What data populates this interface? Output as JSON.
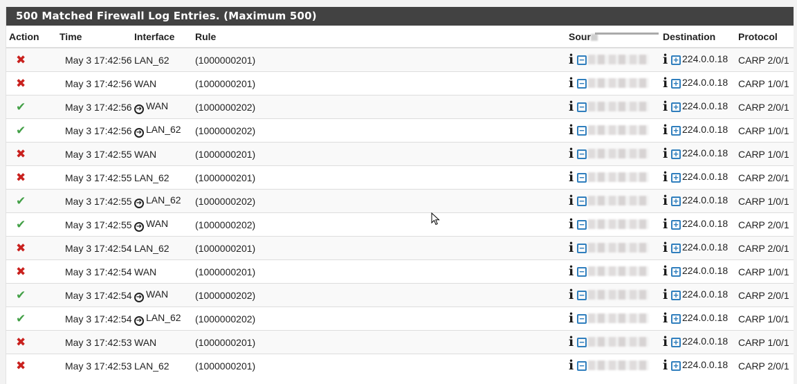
{
  "panel": {
    "title": "500 Matched Firewall Log Entries. (Maximum 500)"
  },
  "table": {
    "headers": {
      "action": "Action",
      "time": "Time",
      "interface": "Interface",
      "rule": "Rule",
      "source": "Sour",
      "destination": "Destination",
      "protocol": "Protocol"
    },
    "rows": [
      {
        "action": "block",
        "time": "May 3 17:42:56",
        "interface": "LAN_62",
        "direction_icon": false,
        "rule": "(1000000201)",
        "source": "[redacted]",
        "destination": "224.0.0.18",
        "protocol": "CARP 2/0/1"
      },
      {
        "action": "block",
        "time": "May 3 17:42:56",
        "interface": "WAN",
        "direction_icon": false,
        "rule": "(1000000201)",
        "source": "[redacted]",
        "destination": "224.0.0.18",
        "protocol": "CARP 1/0/1"
      },
      {
        "action": "pass",
        "time": "May 3 17:42:56",
        "interface": "WAN",
        "direction_icon": true,
        "rule": "(1000000202)",
        "source": "[redacted]",
        "destination": "224.0.0.18",
        "protocol": "CARP 2/0/1"
      },
      {
        "action": "pass",
        "time": "May 3 17:42:56",
        "interface": "LAN_62",
        "direction_icon": true,
        "rule": "(1000000202)",
        "source": "[redacted]",
        "destination": "224.0.0.18",
        "protocol": "CARP 1/0/1"
      },
      {
        "action": "block",
        "time": "May 3 17:42:55",
        "interface": "WAN",
        "direction_icon": false,
        "rule": "(1000000201)",
        "source": "[redacted]",
        "destination": "224.0.0.18",
        "protocol": "CARP 1/0/1"
      },
      {
        "action": "block",
        "time": "May 3 17:42:55",
        "interface": "LAN_62",
        "direction_icon": false,
        "rule": "(1000000201)",
        "source": "[redacted]",
        "destination": "224.0.0.18",
        "protocol": "CARP 2/0/1"
      },
      {
        "action": "pass",
        "time": "May 3 17:42:55",
        "interface": "LAN_62",
        "direction_icon": true,
        "rule": "(1000000202)",
        "source": "[redacted]",
        "destination": "224.0.0.18",
        "protocol": "CARP 1/0/1"
      },
      {
        "action": "pass",
        "time": "May 3 17:42:55",
        "interface": "WAN",
        "direction_icon": true,
        "rule": "(1000000202)",
        "source": "[redacted]",
        "destination": "224.0.0.18",
        "protocol": "CARP 2/0/1"
      },
      {
        "action": "block",
        "time": "May 3 17:42:54",
        "interface": "LAN_62",
        "direction_icon": false,
        "rule": "(1000000201)",
        "source": "[redacted]",
        "destination": "224.0.0.18",
        "protocol": "CARP 2/0/1"
      },
      {
        "action": "block",
        "time": "May 3 17:42:54",
        "interface": "WAN",
        "direction_icon": false,
        "rule": "(1000000201)",
        "source": "[redacted]",
        "destination": "224.0.0.18",
        "protocol": "CARP 1/0/1"
      },
      {
        "action": "pass",
        "time": "May 3 17:42:54",
        "interface": "WAN",
        "direction_icon": true,
        "rule": "(1000000202)",
        "source": "[redacted]",
        "destination": "224.0.0.18",
        "protocol": "CARP 2/0/1"
      },
      {
        "action": "pass",
        "time": "May 3 17:42:54",
        "interface": "LAN_62",
        "direction_icon": true,
        "rule": "(1000000202)",
        "source": "[redacted]",
        "destination": "224.0.0.18",
        "protocol": "CARP 1/0/1"
      },
      {
        "action": "block",
        "time": "May 3 17:42:53",
        "interface": "WAN",
        "direction_icon": false,
        "rule": "(1000000201)",
        "source": "[redacted]",
        "destination": "224.0.0.18",
        "protocol": "CARP 1/0/1"
      },
      {
        "action": "block",
        "time": "May 3 17:42:53",
        "interface": "LAN_62",
        "direction_icon": false,
        "rule": "(1000000201)",
        "source": "[redacted]",
        "destination": "224.0.0.18",
        "protocol": "CARP 2/0/1"
      }
    ]
  },
  "icons": {
    "block": "✖",
    "pass": "✔",
    "direction": "➜",
    "info": "i",
    "minus": "−",
    "plus": "+"
  },
  "colors": {
    "header_bg": "#424242",
    "block": "#c9211e",
    "pass": "#43a047",
    "link_blue": "#2f7ebd",
    "stripe": "#f9f9f9",
    "border": "#dddddd"
  }
}
